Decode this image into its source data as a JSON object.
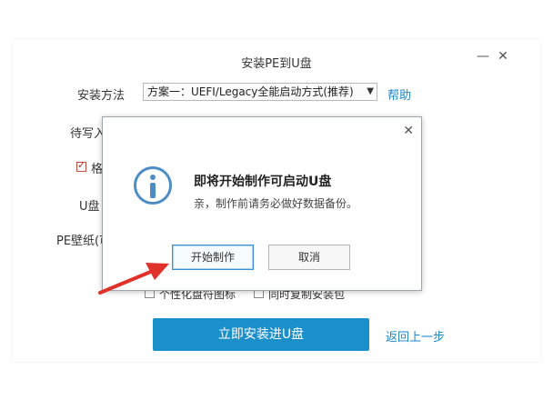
{
  "window": {
    "title": "安装PE到U盘",
    "minimize_label": "—",
    "close_label": "✕"
  },
  "form": {
    "install_method_label": "安装方法",
    "install_method_value": "方案一：UEFI/Legacy全能启动方式(推荐)",
    "help_link": "帮助",
    "write_label_partial": "待写入",
    "format_label_partial": "格",
    "udisk_label_partial": "U盘",
    "wallpaper_label_partial": "PE壁纸(可",
    "option_personalize_label": "个性化盘符图标",
    "option_copy_label": "同时复制安装包"
  },
  "actions": {
    "install_button": "立即安装进U盘",
    "back_link": "返回上一步"
  },
  "dialog": {
    "close_label": "✕",
    "title": "即将开始制作可启动U盘",
    "message": "亲，制作前请务必做好数据备份。",
    "start_button": "开始制作",
    "cancel_button": "取消"
  },
  "colors": {
    "accent": "#1b8fc9",
    "link": "#1f86c8",
    "info_icon": "#4e8cc4",
    "annotation_arrow": "#e0312a"
  }
}
